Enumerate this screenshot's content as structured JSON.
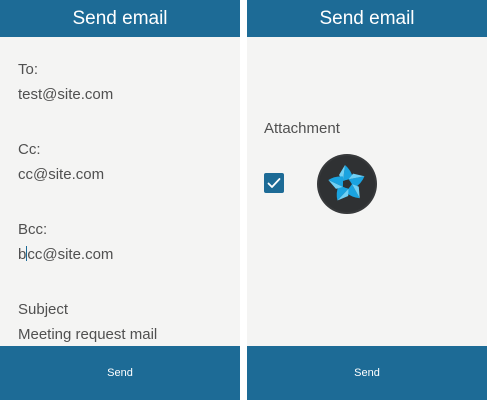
{
  "left_screen": {
    "title": "Send email",
    "to_label": "To:",
    "to_value": "test@site.com",
    "cc_label": "Cc:",
    "cc_value": "cc@site.com",
    "bcc_label": "Bcc:",
    "bcc_value_before_cursor": "b",
    "bcc_value_after_cursor": "cc@site.com",
    "subject_label": "Subject",
    "subject_value": "Meeting request mail",
    "send_label": "Send"
  },
  "right_screen": {
    "title": "Send email",
    "attachment_label": "Attachment",
    "attachment_checked": true,
    "attachment_icon": "tizen-logo-icon",
    "send_label": "Send"
  },
  "colors": {
    "primary": "#1d6b96",
    "background": "#f4f4f3",
    "text": "#505050"
  }
}
